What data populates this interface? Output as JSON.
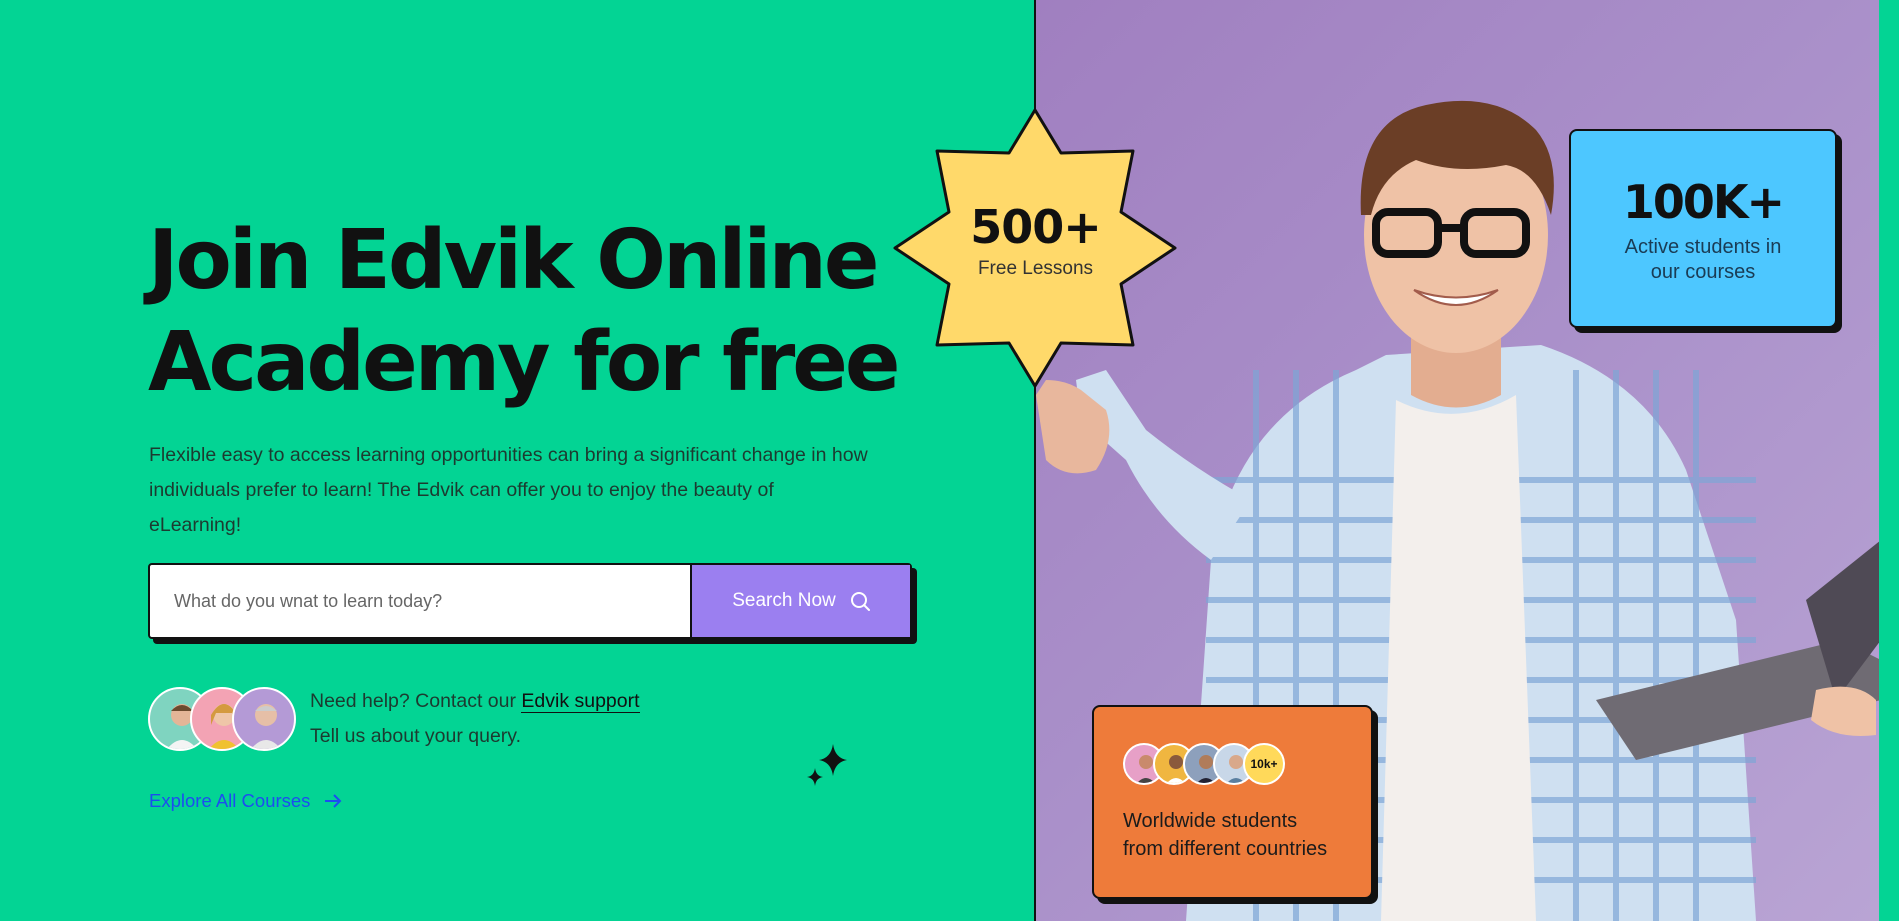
{
  "hero": {
    "headline_line1": "Join Edvik Online",
    "headline_line2": "Academy for free",
    "description": "Flexible easy to access learning opportunities can bring a significant change in how individuals prefer to learn! The Edvik can offer you to enjoy the beauty of eLearning!"
  },
  "search": {
    "placeholder": "What do you wnat to learn today?",
    "button_label": "Search Now",
    "button_icon": "search-icon"
  },
  "help": {
    "prefix": "Need help? Contact our ",
    "link_label": "Edvik support",
    "line2": "Tell us about your query."
  },
  "explore": {
    "label": "Explore All Courses",
    "icon": "arrow-right-icon"
  },
  "badge": {
    "number": "500+",
    "label": "Free Lessons",
    "color": "#ffd96a"
  },
  "stats_card": {
    "number": "100K+",
    "label_line1": "Active students in",
    "label_line2": "our courses",
    "color": "#4dc7ff"
  },
  "students_card": {
    "count_badge": "10k+",
    "label_line1": "Worldwide students",
    "label_line2": "from different countries",
    "color": "#ee7b3a"
  },
  "colors": {
    "green": "#03d494",
    "purple_button": "#9b7ff0",
    "link_blue": "#1d4df0",
    "panel_purple": "#a98fc9"
  }
}
